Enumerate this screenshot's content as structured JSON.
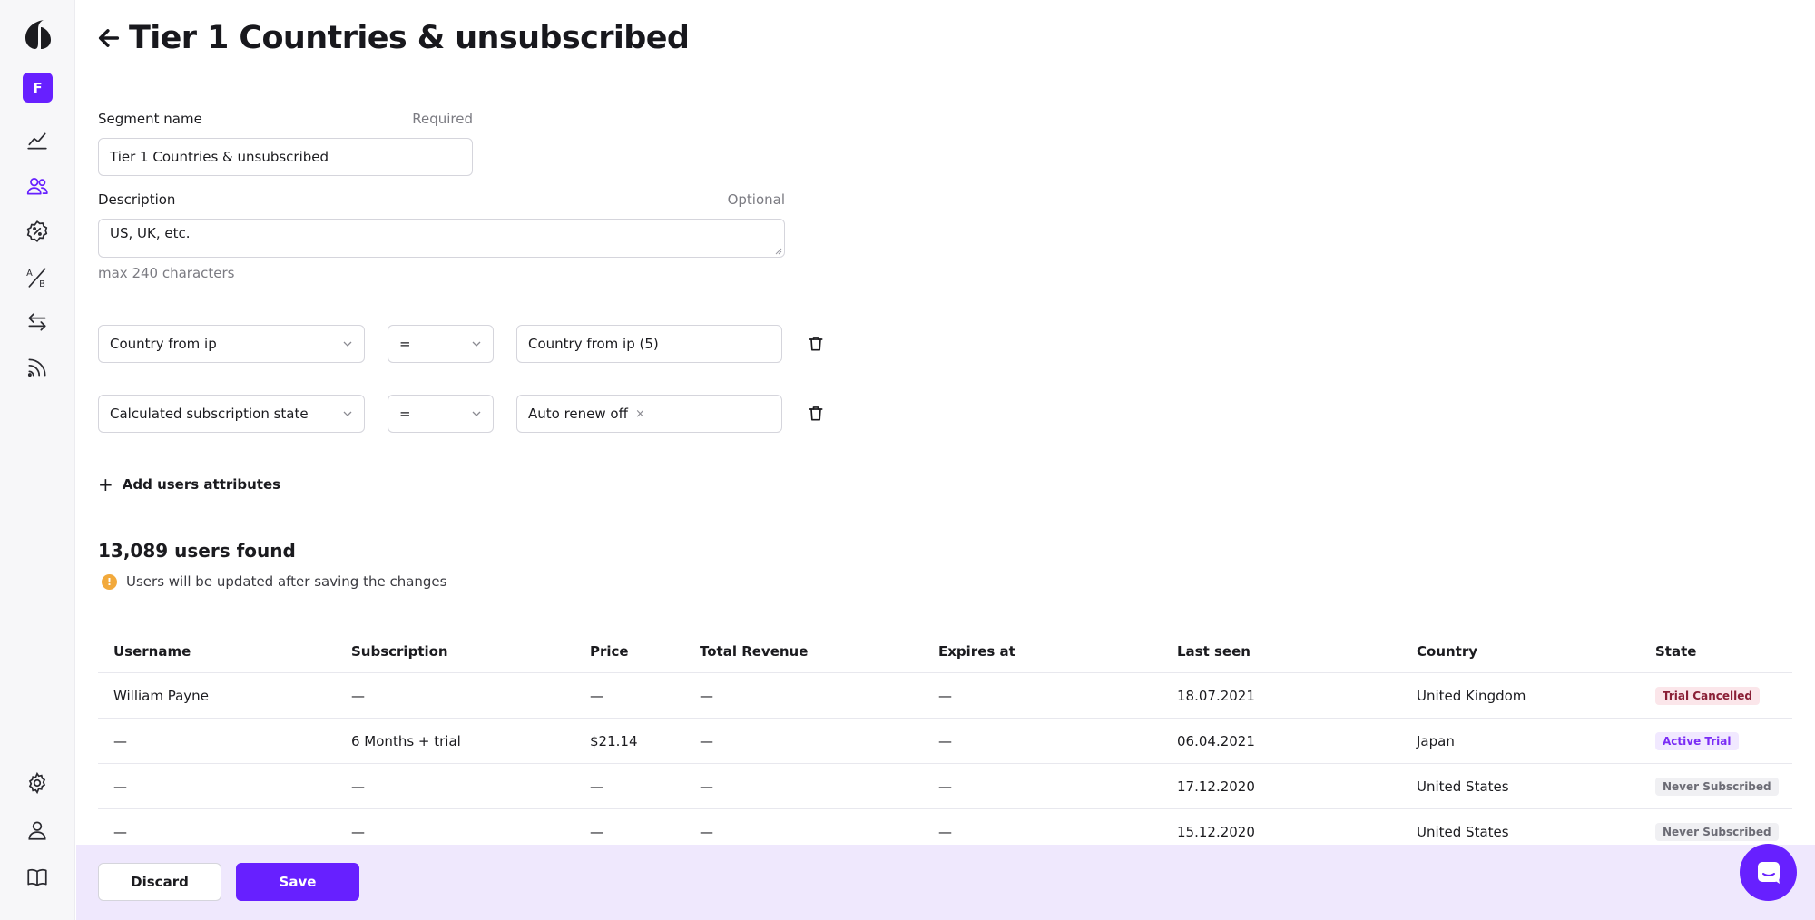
{
  "sidebar": {
    "avatar_letter": "F",
    "items": [
      {
        "icon": "chart-line-icon"
      },
      {
        "icon": "users-icon",
        "active": true
      },
      {
        "icon": "percent-badge-icon"
      },
      {
        "icon": "ab-test-icon"
      },
      {
        "icon": "swap-arrows-icon"
      },
      {
        "icon": "feed-icon"
      }
    ],
    "bottom_items": [
      {
        "icon": "gear-icon"
      },
      {
        "icon": "profile-icon"
      },
      {
        "icon": "book-icon"
      }
    ],
    "accent_color": "#6720FF"
  },
  "header": {
    "title": "Tier 1 Countries & unsubscribed"
  },
  "form": {
    "segment_name_label": "Segment name",
    "segment_name_hint": "Required",
    "segment_name_value": "Tier 1 Countries & unsubscribed",
    "description_label": "Description",
    "description_hint": "Optional",
    "description_value": "US, UK, etc.",
    "description_limit": "max 240 characters"
  },
  "filters": [
    {
      "attribute": "Country from ip",
      "operator": "=",
      "value": "Country from ip (5)"
    },
    {
      "attribute": "Calculated subscription state",
      "operator": "=",
      "value": "Auto renew off",
      "value_removable": "×"
    }
  ],
  "add_attributes_label": "Add users attributes",
  "results": {
    "count_text": "13,089 users found",
    "notice": "Users will be updated after saving the changes",
    "notice_icon": "!"
  },
  "table": {
    "columns": [
      "Username",
      "Subscription",
      "Price",
      "Total Revenue",
      "Expires at",
      "Last seen",
      "Country",
      "State"
    ],
    "rows": [
      [
        "William Payne",
        "—",
        "—",
        "—",
        "—",
        "18.07.2021",
        "United Kingdom",
        "Trial Cancelled"
      ],
      [
        "—",
        "6 Months + trial",
        "$21.14",
        "—",
        "—",
        "06.04.2021",
        "Japan",
        "Active Trial"
      ],
      [
        "—",
        "—",
        "—",
        "—",
        "—",
        "17.12.2020",
        "United States",
        "Never Subscribed"
      ],
      [
        "—",
        "—",
        "—",
        "—",
        "—",
        "15.12.2020",
        "United States",
        "Never Subscribed"
      ]
    ],
    "state_colors": {
      "Trial Cancelled": "#8A1F36",
      "Active Trial": "#7A2CF5",
      "Never Subscribed": "#6B6B74"
    }
  },
  "footer": {
    "discard_label": "Discard",
    "save_label": "Save"
  }
}
